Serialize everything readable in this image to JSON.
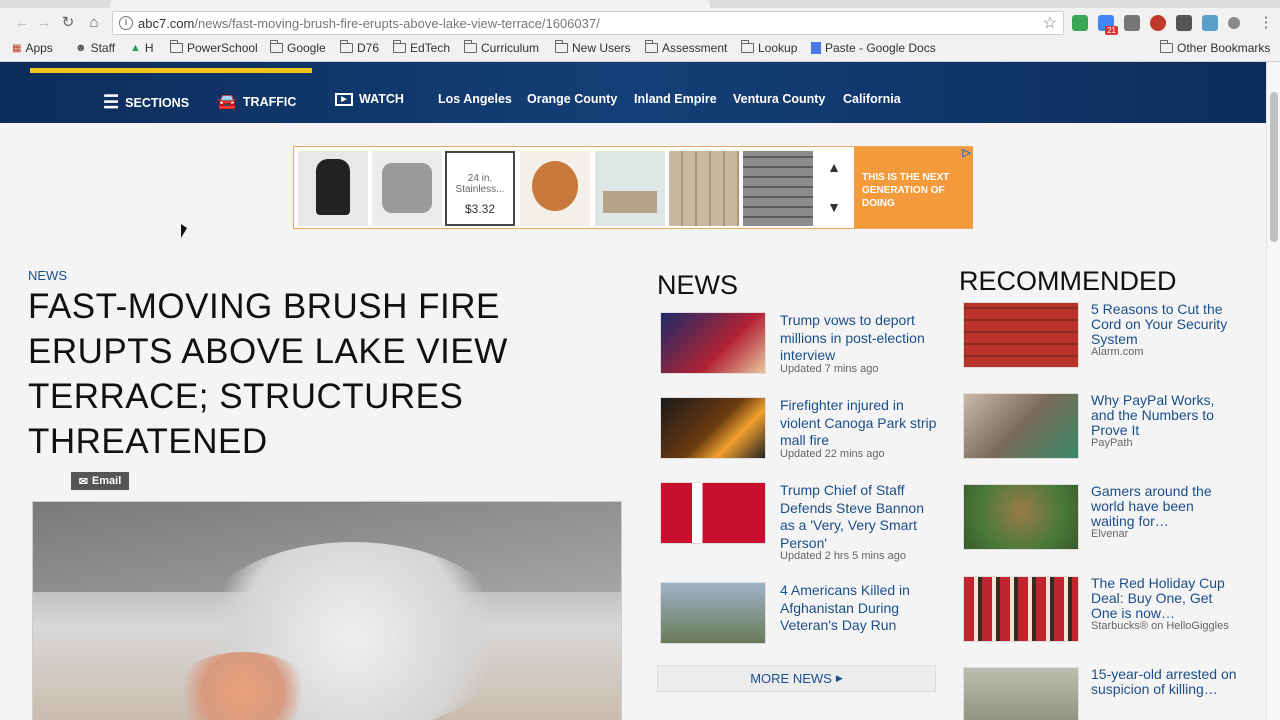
{
  "browser": {
    "url_main": "abc7.com",
    "url_path": "/news/fast-moving-brush-fire-erupts-above-lake-view-terrace/1606037/",
    "ext_badge": "21",
    "bookmarks": [
      {
        "label": "Apps",
        "icon": "apps-grid-icon"
      },
      {
        "label": "Staff",
        "icon": "person-icon"
      },
      {
        "label": "H",
        "icon": "drive-icon"
      },
      {
        "label": "PowerSchool",
        "icon": "folder-icon"
      },
      {
        "label": "Google",
        "icon": "folder-icon"
      },
      {
        "label": "D76",
        "icon": "folder-icon"
      },
      {
        "label": "EdTech",
        "icon": "folder-icon"
      },
      {
        "label": "Curriculum",
        "icon": "folder-icon"
      },
      {
        "label": "New Users",
        "icon": "folder-icon"
      },
      {
        "label": "Assessment",
        "icon": "folder-icon"
      },
      {
        "label": "Lookup",
        "icon": "folder-icon"
      },
      {
        "label": "Paste - Google Docs",
        "icon": "docs-icon"
      }
    ],
    "other_bookmarks": "Other Bookmarks"
  },
  "site_nav": {
    "sections": "SECTIONS",
    "traffic": "TRAFFIC",
    "watch": "WATCH",
    "cities": [
      "Los Angeles",
      "Orange County",
      "Inland Empire",
      "Ventura County",
      "California"
    ],
    "progress": 0.25
  },
  "ad": {
    "product_text": "24 in. Stainless...",
    "product_price": "$3.32",
    "banner_text": "THIS IS THE NEXT GENERATION OF DOING",
    "up_arrow": "▲",
    "down_arrow": "▼"
  },
  "article": {
    "category": "NEWS",
    "headline": "FAST-MOVING BRUSH FIRE ERUPTS ABOVE LAKE VIEW TERRACE; STRUCTURES THREATENED",
    "email_label": "Email"
  },
  "news": {
    "title": "NEWS",
    "items": [
      {
        "title": "Trump vows to deport millions in post-election interview",
        "meta": "Updated 7 mins ago"
      },
      {
        "title": "Firefighter injured in violent Canoga Park strip mall fire",
        "meta": "Updated 22 mins ago"
      },
      {
        "title": "Trump Chief of Staff Defends Steve Bannon as a 'Very, Very Smart Person'",
        "meta": "Updated 2 hrs 5 mins ago"
      },
      {
        "title": "4 Americans Killed in Afghanistan During Veteran's Day Run",
        "meta": ""
      }
    ],
    "more": "MORE NEWS"
  },
  "recommended": {
    "title": "RECOMMENDED",
    "items": [
      {
        "title": "5 Reasons to Cut the Cord on Your Security System",
        "meta": "Alarm.com"
      },
      {
        "title": "Why PayPal Works, and the Numbers to Prove It",
        "meta": "PayPath"
      },
      {
        "title": "Gamers around the world have been waiting for…",
        "meta": "Elvenar"
      },
      {
        "title": "The Red Holiday Cup Deal: Buy One, Get One is now…",
        "meta": "Starbucks® on HelloGiggles"
      },
      {
        "title": "15-year-old arrested on suspicion of killing…",
        "meta": ""
      }
    ]
  },
  "colors": {
    "nav_bg": "#0c2d5a",
    "link_blue": "#1b4f8a",
    "progress_yellow": "#f0c419",
    "ad_orange": "#f39a3c"
  }
}
